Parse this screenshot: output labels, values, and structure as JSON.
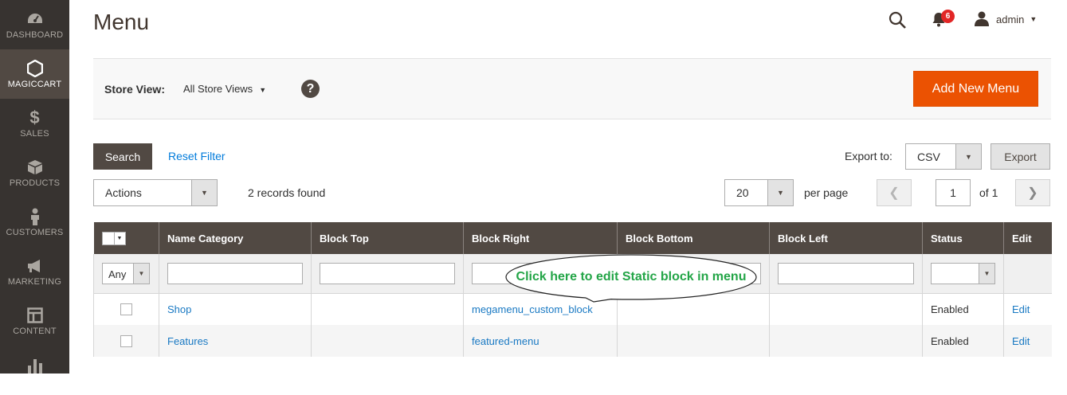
{
  "sidebar": {
    "items": [
      {
        "label": "DASHBOARD",
        "icon": "dashboard-icon"
      },
      {
        "label": "MAGICCART",
        "icon": "hexagon-icon",
        "active": true
      },
      {
        "label": "SALES",
        "icon": "dollar-icon"
      },
      {
        "label": "PRODUCTS",
        "icon": "box-icon"
      },
      {
        "label": "CUSTOMERS",
        "icon": "person-icon"
      },
      {
        "label": "MARKETING",
        "icon": "megaphone-icon"
      },
      {
        "label": "CONTENT",
        "icon": "layout-icon"
      },
      {
        "label": "",
        "icon": "bar-chart-icon"
      }
    ]
  },
  "header": {
    "title": "Menu",
    "notifications_count": "6",
    "user": "admin"
  },
  "store_bar": {
    "label": "Store View:",
    "selected": "All Store Views",
    "help": "?",
    "add_button": "Add New Menu"
  },
  "toolbar": {
    "search": "Search",
    "reset": "Reset Filter",
    "export_label": "Export to:",
    "export_format": "CSV",
    "export_button": "Export",
    "actions": "Actions",
    "records": "2 records found",
    "per_page_value": "20",
    "per_page_label": "per page",
    "page": "1",
    "of_pages": "of 1"
  },
  "grid": {
    "columns": [
      "Name Category",
      "Block Top",
      "Block Right",
      "Block Bottom",
      "Block Left",
      "Status",
      "Edit"
    ],
    "filter_any": "Any",
    "rows": [
      {
        "name": "Shop",
        "block_top": "",
        "block_right": "megamenu_custom_block",
        "block_bottom": "",
        "block_left": "",
        "status": "Enabled",
        "edit": "Edit"
      },
      {
        "name": "Features",
        "block_top": "",
        "block_right": "featured-menu",
        "block_bottom": "",
        "block_left": "",
        "status": "Enabled",
        "edit": "Edit"
      }
    ]
  },
  "annotation": {
    "text": "Click here to edit Static block in menu"
  },
  "colors": {
    "sidebar_bg": "#373330",
    "sidebar_active": "#514943",
    "primary_button": "#eb5202",
    "link": "#1979c3",
    "annotation_text": "#23a547"
  }
}
